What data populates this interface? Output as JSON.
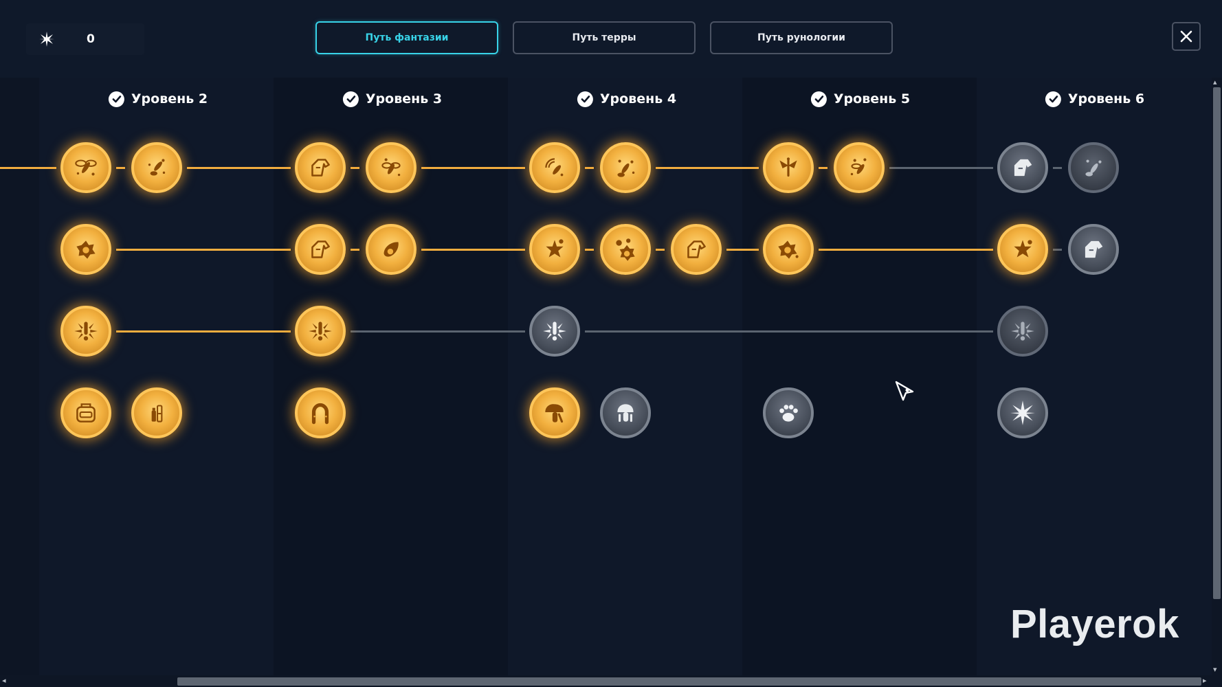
{
  "currency": {
    "value": "0",
    "icon": "star-burst-icon"
  },
  "tabs": [
    {
      "label": "Путь фантазии",
      "active": true
    },
    {
      "label": "Путь терры",
      "active": false
    },
    {
      "label": "Путь рунологии",
      "active": false
    }
  ],
  "close": {
    "icon": "close-icon"
  },
  "levels": [
    {
      "label": "Уровень 2",
      "completed": true
    },
    {
      "label": "Уровень 3",
      "completed": true
    },
    {
      "label": "Уровень 4",
      "completed": true
    },
    {
      "label": "Уровень 5",
      "completed": true
    },
    {
      "label": "Уровень 6",
      "completed": true
    }
  ],
  "colors": {
    "accent": "#38d3e8",
    "unlocked": "#f2ad3f",
    "locked": "#5b6470",
    "background": "#0c1424"
  },
  "watermark": "Playerok",
  "node_states": {
    "row1": [
      "unlocked",
      "unlocked",
      "unlocked",
      "unlocked",
      "unlocked",
      "unlocked",
      "unlocked",
      "unlocked",
      "locked",
      "locked"
    ],
    "row2": [
      "unlocked",
      "unlocked",
      "unlocked",
      "unlocked",
      "unlocked",
      "unlocked",
      "unlocked",
      "unlocked",
      "locked"
    ],
    "row3": [
      "unlocked",
      "unlocked",
      "locked",
      "locked"
    ],
    "row4": [
      "unlocked",
      "unlocked",
      "unlocked",
      "unlocked",
      "locked",
      "locked",
      "locked"
    ]
  }
}
